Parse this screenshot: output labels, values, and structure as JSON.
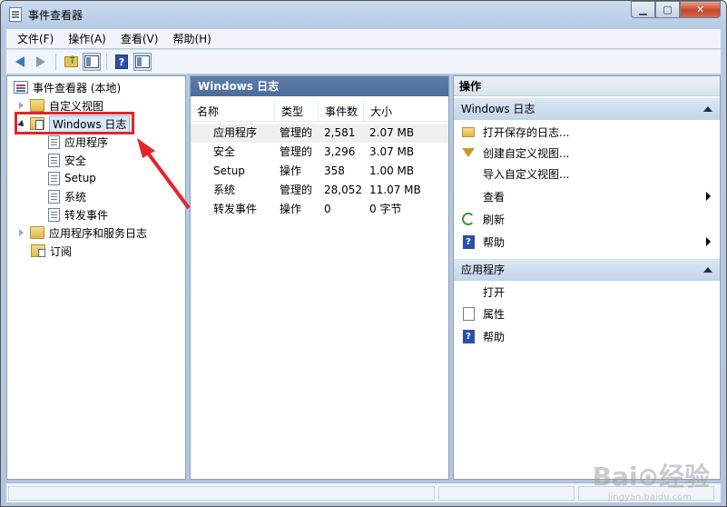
{
  "window": {
    "title": "事件查看器"
  },
  "menubar": {
    "items": [
      "文件(F)",
      "操作(A)",
      "查看(V)",
      "帮助(H)"
    ]
  },
  "tree": {
    "root": "事件查看器 (本地)",
    "custom_views": "自定义视图",
    "windows_logs": "Windows 日志",
    "logs": [
      "应用程序",
      "安全",
      "Setup",
      "系统",
      "转发事件"
    ],
    "app_service_logs": "应用程序和服务日志",
    "subscriptions": "订阅"
  },
  "middle": {
    "header": "Windows 日志",
    "columns": [
      "名称",
      "类型",
      "事件数",
      "大小"
    ],
    "rows": [
      [
        "应用程序",
        "管理的",
        "2,581",
        "2.07 MB"
      ],
      [
        "安全",
        "管理的",
        "3,296",
        "3.07 MB"
      ],
      [
        "Setup",
        "操作",
        "358",
        "1.00 MB"
      ],
      [
        "系统",
        "管理的",
        "28,052",
        "11.07 MB"
      ],
      [
        "转发事件",
        "操作",
        "0",
        "0 字节"
      ]
    ]
  },
  "actions": {
    "title": "操作",
    "section1": {
      "header": "Windows 日志",
      "items": [
        "打开保存的日志...",
        "创建自定义视图...",
        "导入自定义视图...",
        "查看",
        "刷新",
        "帮助"
      ]
    },
    "section2": {
      "header": "应用程序",
      "items": [
        "打开",
        "属性",
        "帮助"
      ]
    }
  },
  "watermark": {
    "brand": "Bai⊙经验",
    "url": "jingyan.baidu.com"
  }
}
